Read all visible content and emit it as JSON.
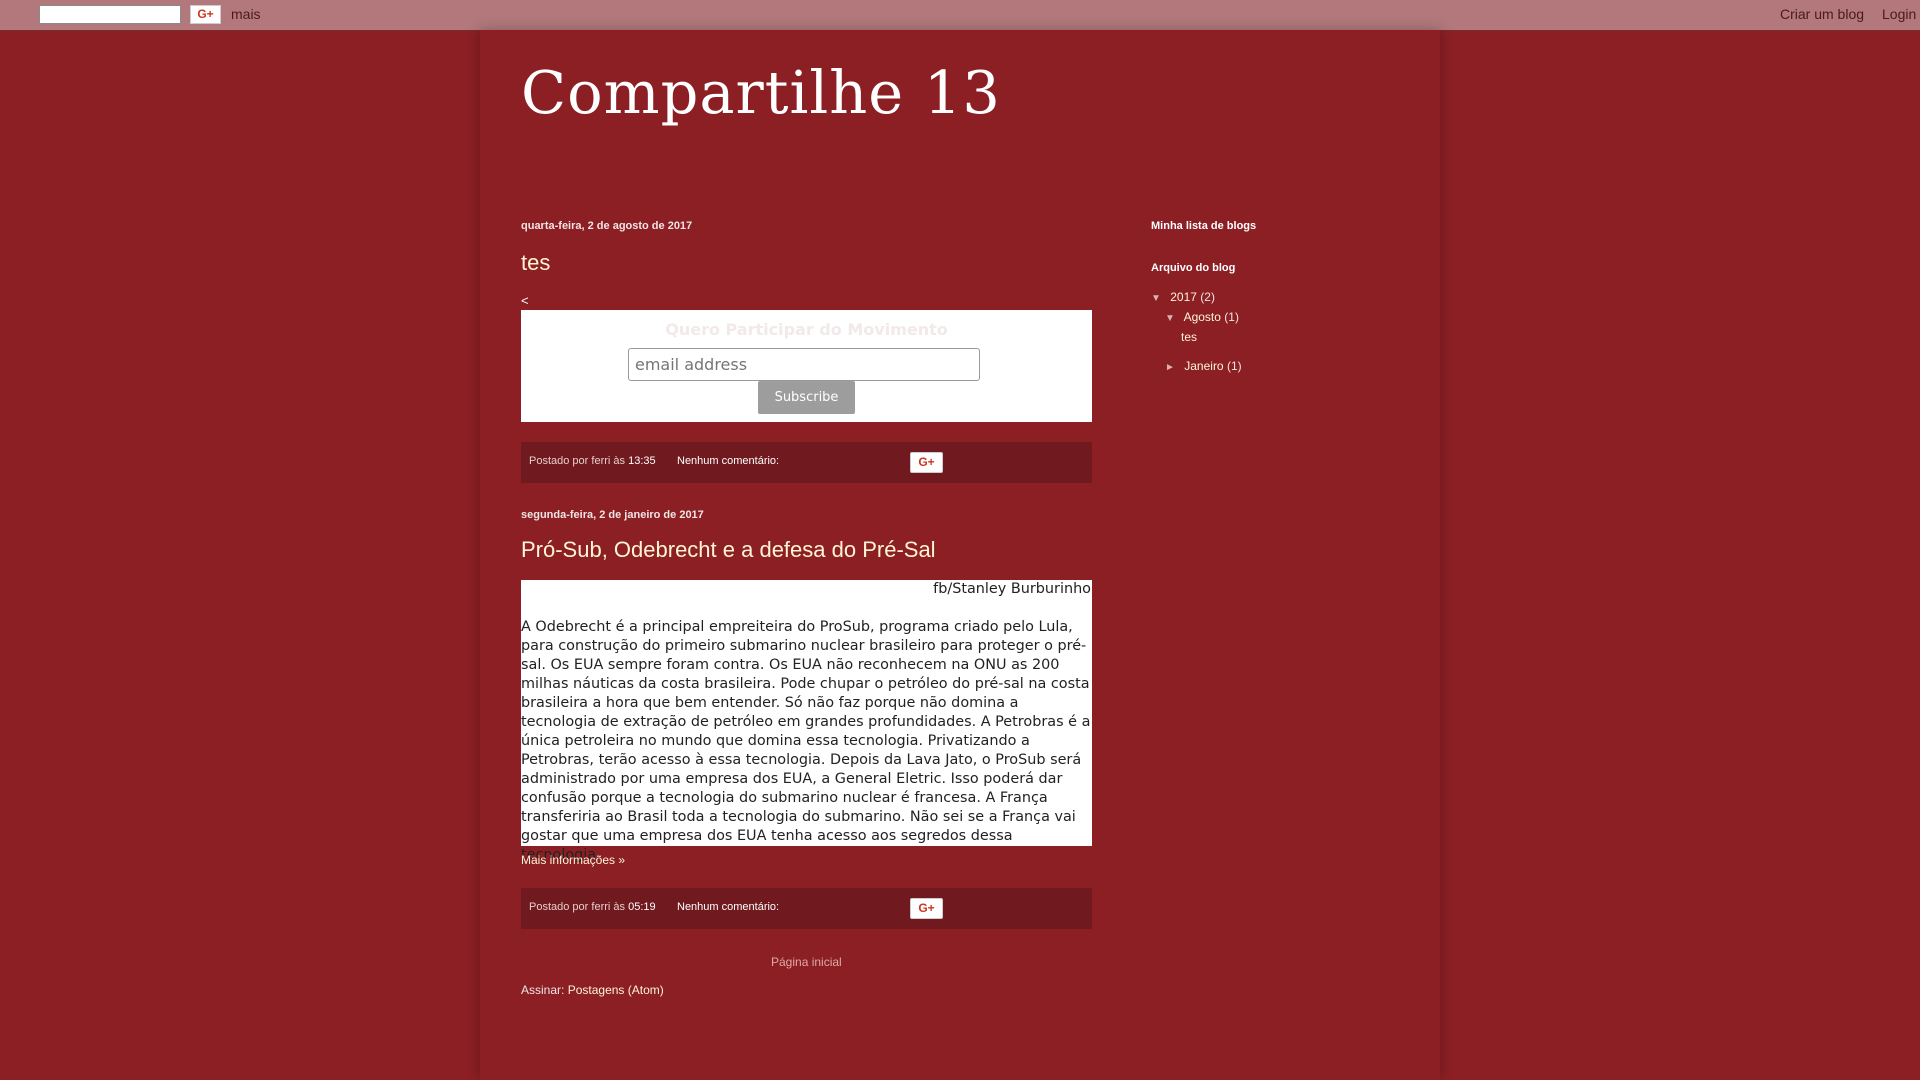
{
  "navbar": {
    "gplus_label": "G+",
    "more_label": "mais",
    "create_blog": "Criar um blog",
    "login": "Login"
  },
  "blog": {
    "title": "Compartilhe 13"
  },
  "posts": [
    {
      "date": "quarta-feira, 2 de agosto de 2017",
      "title": "tes",
      "stray_char": "<",
      "form": {
        "heading": "Quero Participar do Movimento",
        "email_placeholder": "email address",
        "button": "Subscribe"
      },
      "footer": {
        "posted_by": "Postado por",
        "author": "ferri",
        "at": "às",
        "time": "13:35",
        "comments": "Nenhum comentário:",
        "gplus": "G+"
      }
    },
    {
      "date": "segunda-feira, 2 de janeiro de 2017",
      "title": "Pró-Sub, Odebrecht e a defesa do Pré-Sal",
      "credit": "fb/Stanley Burburinho",
      "body": "A Odebrecht é a principal empreiteira do ProSub, programa criado pelo Lula, para construção do primeiro submarino nuclear brasileiro para proteger o pré-sal. Os EUA sempre foram contra. Os EUA não reconhecem na ONU as 200 milhas náuticas da costa brasileira. Pode chupar o petróleo do pré-sal na costa brasileira a hora que bem entender. Só não faz porque não domina a tecnologia de extração de petróleo em grandes profundidades. A Petrobras é a única petroleira no mundo que domina essa tecnologia. Privatizando a Petrobras, terão acesso à essa tecnologia. Depois da Lava Jato, o ProSub será administrado por uma empresa dos EUA, a General Eletric. Isso poderá dar confusão porque a tecnologia do submarino nuclear é francesa. A França transferiria ao Brasil toda a tecnologia do submarino. Não sei se a França vai gostar que uma empresa dos EUA tenha acesso aos segredos dessa tecnologia.",
      "more": "Mais informações »",
      "footer": {
        "posted_by": "Postado por",
        "author": "ferri",
        "at": "às",
        "time": "05:19",
        "comments": "Nenhum comentário:",
        "gplus": "G+"
      }
    }
  ],
  "pager": {
    "home": "Página inicial"
  },
  "feed": {
    "label": "Assinar:",
    "link": "Postagens (Atom)"
  },
  "sidebar": {
    "blog_list_heading": "Minha lista de blogs",
    "archive_heading": "Arquivo do blog",
    "archive": {
      "year": {
        "toggle": "▼",
        "label": "2017",
        "count": "(2)"
      },
      "months": [
        {
          "toggle": "▼",
          "label": "Agosto",
          "count": "(1)",
          "posts": [
            "tes"
          ]
        },
        {
          "toggle": "►",
          "label": "Janeiro",
          "count": "(1)"
        }
      ]
    }
  }
}
